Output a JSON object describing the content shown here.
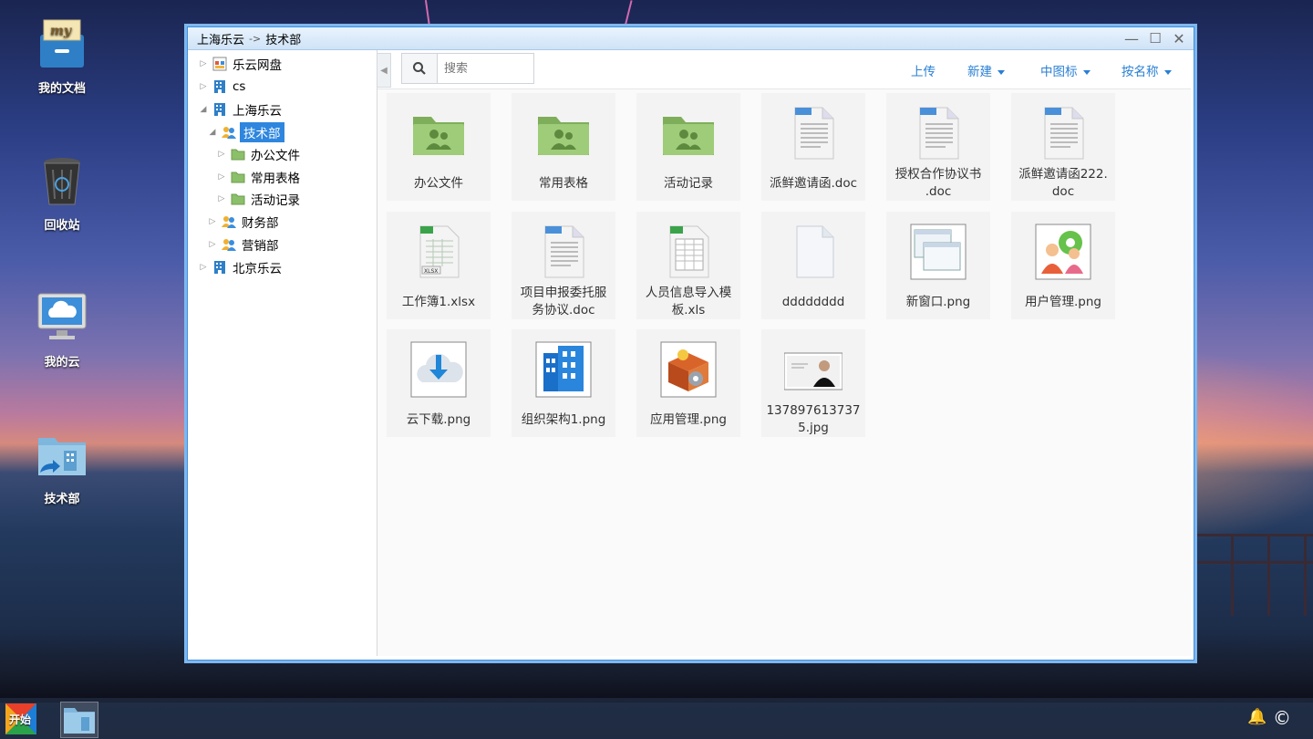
{
  "window": {
    "title_root": "上海乐云",
    "title_arrow": "->",
    "title_current": "技术部",
    "minimize": "—",
    "maximize": "☐",
    "close": "✕"
  },
  "desktop": [
    {
      "label": "我的文档",
      "icon": "my-documents-icon"
    },
    {
      "label": "回收站",
      "icon": "recycle-bin-icon"
    },
    {
      "label": "我的云",
      "icon": "my-cloud-icon"
    },
    {
      "label": "技术部",
      "icon": "dept-shortcut-icon"
    }
  ],
  "tree": [
    {
      "label": "乐云网盘",
      "icon": "cloud-disk-icon",
      "expanded": false,
      "selected": false
    },
    {
      "label": "cs",
      "icon": "building-icon",
      "expanded": false,
      "selected": false
    },
    {
      "label": "上海乐云",
      "icon": "building-icon",
      "expanded": true,
      "selected": false
    },
    {
      "label": "技术部",
      "icon": "users-icon",
      "expanded": true,
      "selected": true
    },
    {
      "label": "办公文件",
      "icon": "folder-icon",
      "expanded": false,
      "selected": false
    },
    {
      "label": "常用表格",
      "icon": "folder-icon",
      "expanded": false,
      "selected": false
    },
    {
      "label": "活动记录",
      "icon": "folder-icon",
      "expanded": false,
      "selected": false
    },
    {
      "label": "财务部",
      "icon": "users-icon",
      "expanded": false,
      "selected": false
    },
    {
      "label": "营销部",
      "icon": "users-icon",
      "expanded": false,
      "selected": false
    },
    {
      "label": "北京乐云",
      "icon": "building-icon",
      "expanded": false,
      "selected": false
    }
  ],
  "toolbar": {
    "search_placeholder": "搜索",
    "upload": "上传",
    "new": "新建",
    "view": "中图标",
    "sort": "按名称"
  },
  "files": [
    {
      "name": "办公文件",
      "type": "shared-folder"
    },
    {
      "name": "常用表格",
      "type": "shared-folder"
    },
    {
      "name": "活动记录",
      "type": "shared-folder"
    },
    {
      "name": "派鲜邀请函.doc",
      "type": "doc"
    },
    {
      "name": "授权合作协议书.doc",
      "type": "doc",
      "line1": "授权合作协议书",
      "line2": ".doc"
    },
    {
      "name": "派鲜邀请函222.doc",
      "type": "doc",
      "line1": "派鲜邀请函222.",
      "line2": "doc"
    },
    {
      "name": "工作簿1.xlsx",
      "type": "xlsx"
    },
    {
      "name": "项目申报委托服务协议.doc",
      "type": "doc",
      "line1": "项目申报委托服",
      "line2": "务协议.doc"
    },
    {
      "name": "人员信息导入模板.xls",
      "type": "xls",
      "line1": "人员信息导入模",
      "line2": "板.xls"
    },
    {
      "name": "dddddddd",
      "type": "blank"
    },
    {
      "name": "新窗口.png",
      "type": "png-window"
    },
    {
      "name": "用户管理.png",
      "type": "png-users"
    },
    {
      "name": "云下载.png",
      "type": "png-cloud"
    },
    {
      "name": "组织架构1.png",
      "type": "png-building"
    },
    {
      "name": "应用管理.png",
      "type": "png-box"
    },
    {
      "name": "1378976137375.jpg",
      "type": "jpg-photo",
      "line1": "137897613737",
      "line2": "5.jpg"
    }
  ],
  "taskbar": {
    "start": "开始",
    "bell": "🔔",
    "copyright": "©"
  },
  "colors": {
    "accent": "#2a7fd4",
    "selection": "#2e86de",
    "folder_green": "#8cbf6a",
    "window_border": "#3a8ee0"
  }
}
